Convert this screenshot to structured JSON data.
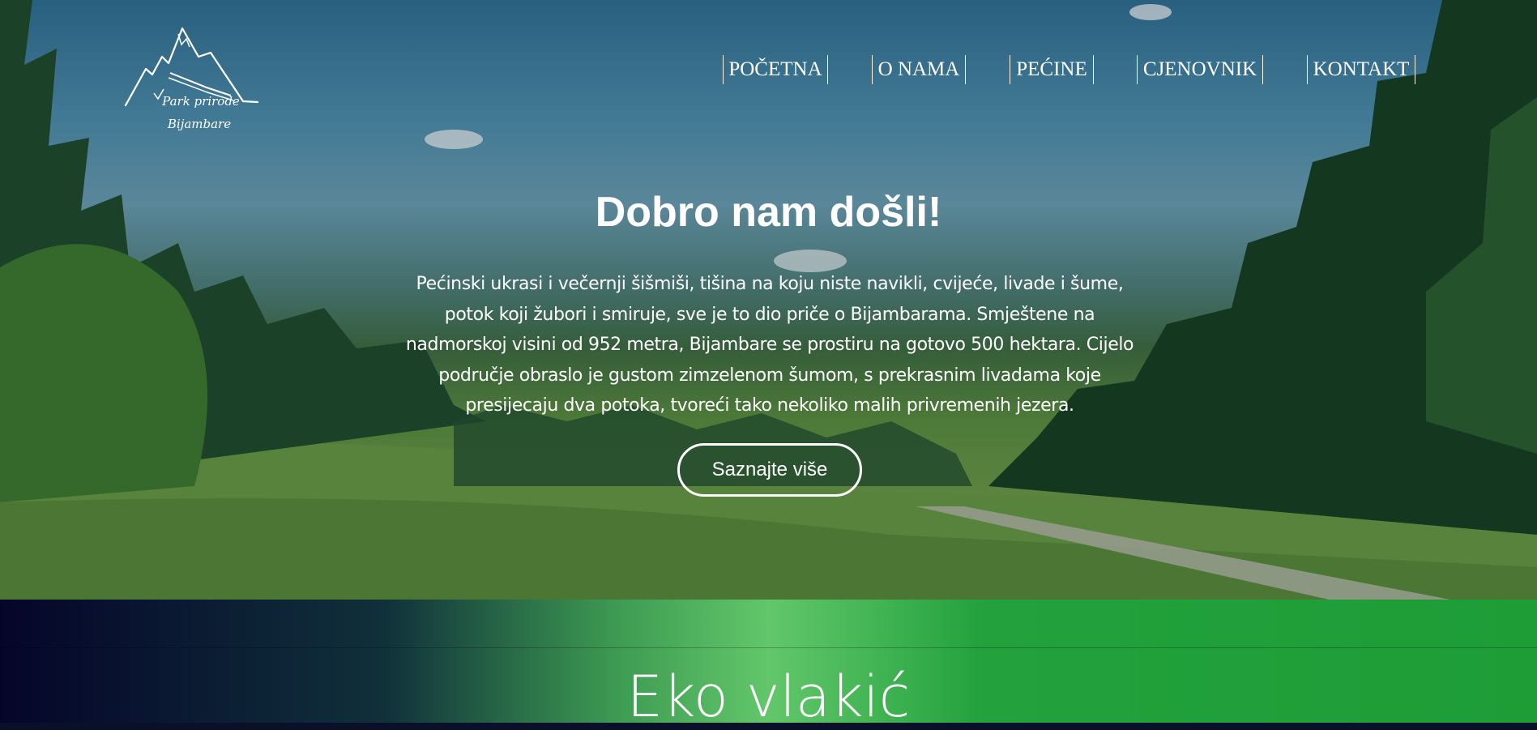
{
  "brand": {
    "line1": "Park prirode",
    "line2": "Bijambare",
    "logo_icon": "mountain-logo-icon"
  },
  "nav": {
    "items": [
      {
        "label": "POČETNA"
      },
      {
        "label": "O NAMA"
      },
      {
        "label": "PEĆINE"
      },
      {
        "label": "CJENOVNIK"
      },
      {
        "label": "KONTAKT"
      }
    ]
  },
  "hero": {
    "title": "Dobro nam došli!",
    "intro_lines": [
      "Pećinski ukrasi i večernji šišmiši, tišina na koju niste navikli, cvijeće, livade i šume,",
      "potok koji žubori i smiruje, sve je to dio priče o Bijambarama. Smještene na",
      "nadmorskoj visini od 952 metra, Bijambare se prostiru na gotovo 500 hektara. Cijelo",
      "područje obraslo je gustom zimzelenom šumom, s prekrasnim livadama koje",
      "presijecaju dva potoka, tvoreći tako nekoliko malih privremenih jezera."
    ],
    "cta_label": "Saznajte više"
  },
  "section": {
    "title": "Eko vlakić"
  },
  "colors": {
    "text": "#ffffff",
    "green": "#1e9d37",
    "light_green": "#62c76a",
    "navy": "#05052a"
  }
}
